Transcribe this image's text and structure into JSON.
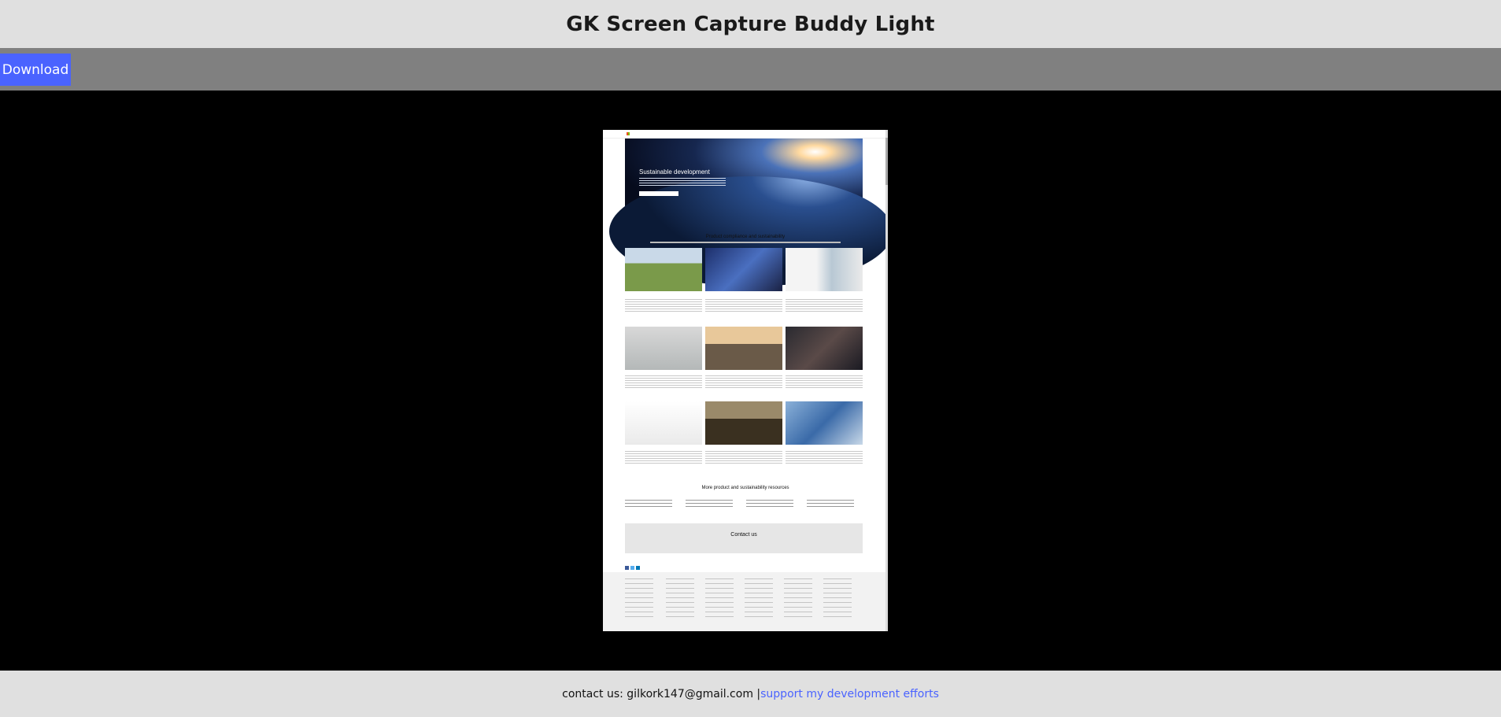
{
  "app": {
    "title": "GK Screen Capture Buddy Light"
  },
  "toolbar": {
    "download_label": "Download"
  },
  "capture": {
    "hero_title": "Sustainable development",
    "section_title": "Product compliance and sustainability",
    "resources_title": "More product and sustainability resources",
    "contact_title": "Contact us"
  },
  "footer": {
    "contact_prefix": "contact us: gilkork147@gmail.com |",
    "support_link": "support my development efforts"
  },
  "colors": {
    "accent": "#4a63ff",
    "topbar": "#e0e0e0",
    "toolbar": "#808080",
    "stage": "#000000"
  }
}
